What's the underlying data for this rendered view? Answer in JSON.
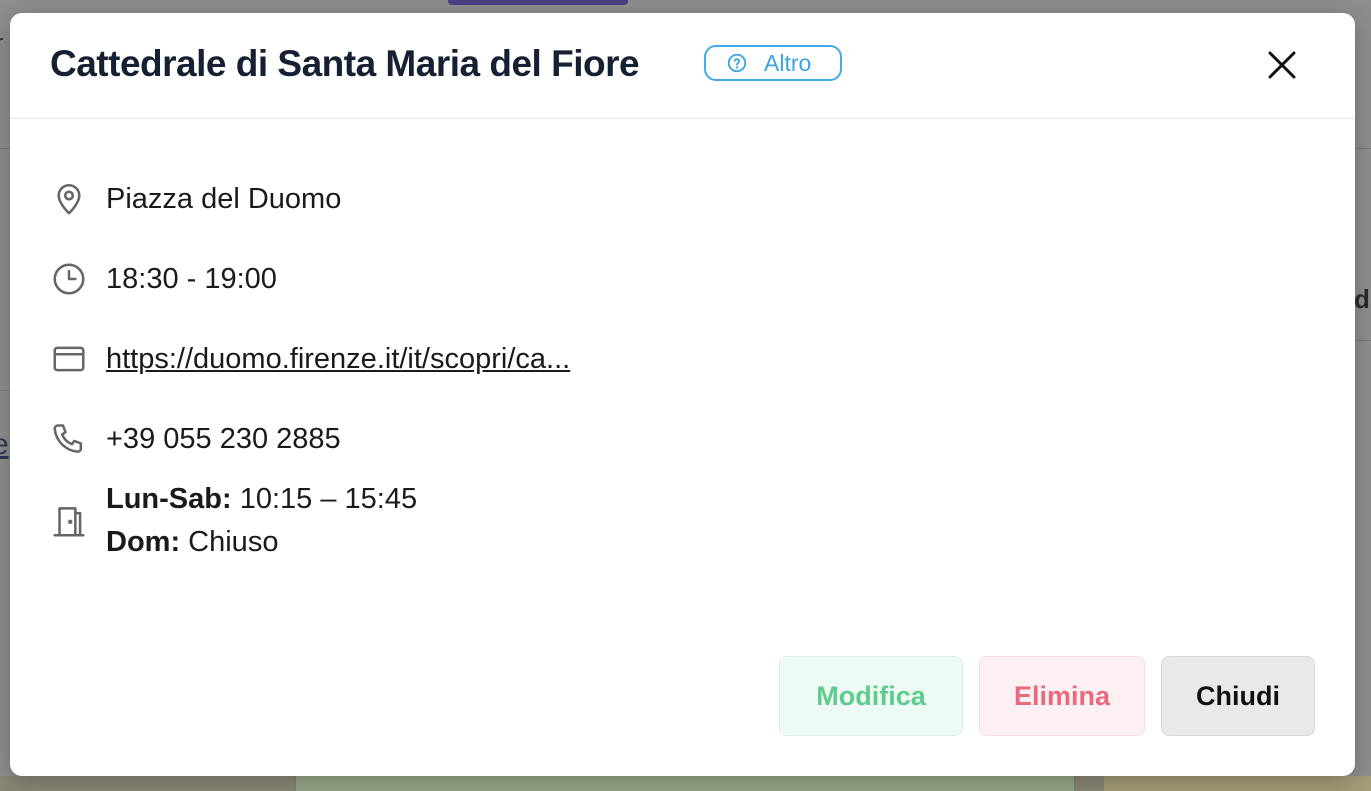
{
  "background": {
    "left_text": "r",
    "left_text_2": "e",
    "right_text": "di"
  },
  "modal": {
    "title": "Cattedrale di Santa Maria del Fiore",
    "category": {
      "label": "Altro",
      "icon": "question-circle-icon",
      "color": "#3aa4e2"
    },
    "close_icon": "close-icon",
    "address": "Piazza del Duomo",
    "time": "18:30 - 19:00",
    "url": "https://duomo.firenze.it/it/scopri/ca...",
    "phone": "+39 055 230 2885",
    "hours": [
      {
        "day": "Lun-Sab:",
        "value": "10:15 – 15:45"
      },
      {
        "day": "Dom:",
        "value": "Chiuso"
      }
    ],
    "buttons": {
      "edit": "Modifica",
      "delete": "Elimina",
      "close": "Chiudi"
    }
  },
  "colors": {
    "edit": "#5fcc8e",
    "delete": "#e96a80",
    "title": "#152033"
  }
}
